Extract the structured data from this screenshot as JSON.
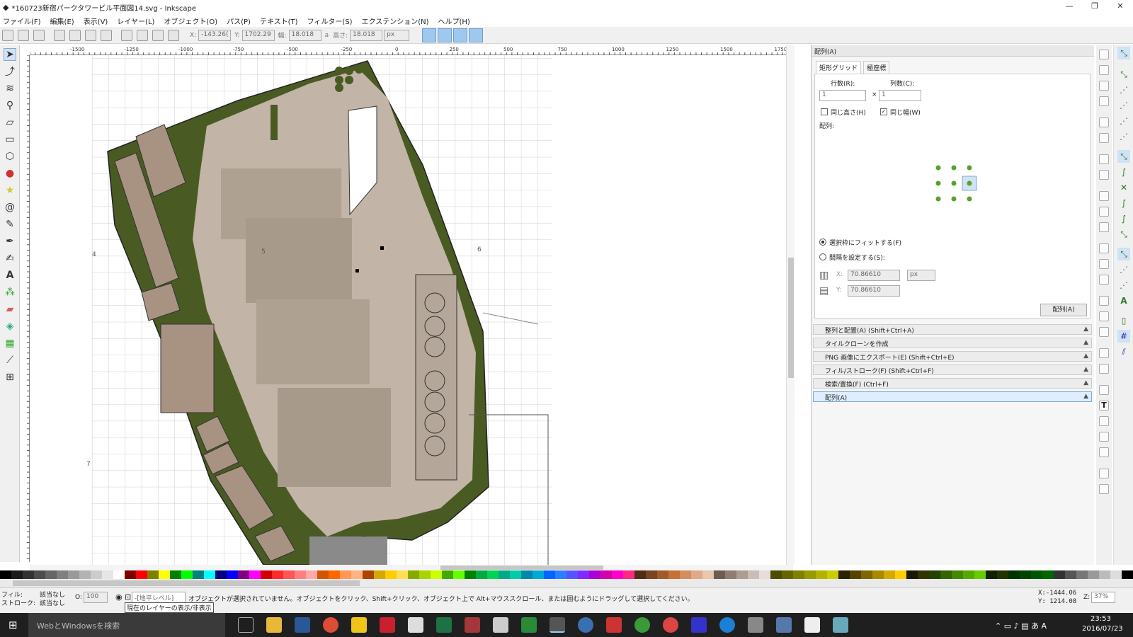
{
  "window": {
    "title": "*160723新宿パークタワービル平面図14.svg - Inkscape",
    "minimize": "—",
    "maximize": "❐",
    "close": "✕"
  },
  "menu": [
    "ファイル(F)",
    "編集(E)",
    "表示(V)",
    "レイヤー(L)",
    "オブジェクト(O)",
    "パス(P)",
    "テキスト(T)",
    "フィルター(S)",
    "エクステンション(N)",
    "ヘルプ(H)"
  ],
  "toolcontrols": {
    "x_label": "X:",
    "x_value": "-143.26(",
    "y_label": "Y:",
    "y_value": "1702.29",
    "w_label": "幅:",
    "w_value": "18.018",
    "h_label": "高さ:",
    "h_value": "18.018",
    "unit": "px"
  },
  "ruler": {
    "h_ticks": [
      "-1500",
      "-1250",
      "-1000",
      "-750",
      "-500",
      "-250",
      "0",
      "250",
      "500",
      "750",
      "1000",
      "1250",
      "1500",
      "1750"
    ]
  },
  "canvas": {
    "labels": [
      "4",
      "5",
      "6",
      "7"
    ]
  },
  "panel": {
    "title": "配列(A)",
    "tabs": [
      "矩形グリッド",
      "極座標"
    ],
    "rows_label": "行数(R):",
    "rows_value": "1",
    "times": "×",
    "cols_label": "列数(C):",
    "cols_value": "1",
    "same_height": "同じ高さ(H)",
    "same_width": "同じ幅(W)",
    "align_label": "配列:",
    "fit_bbox": "選択枠にフィットする(F)",
    "set_spacing": "間隔を設定する(S):",
    "x_label": "X:",
    "x_value": "70.86610",
    "y_label": "Y:",
    "y_value": "70.86610",
    "unit": "px",
    "arrange_button": "配列(A)",
    "docks": [
      "整列と配置(A) (Shift+Ctrl+A)",
      "タイルクローンを作成",
      "PNG 画像にエクスポート(E) (Shift+Ctrl+E)",
      "フィル/ストローク(F) (Shift+Ctrl+F)",
      "検索/置換(F) (Ctrl+F)",
      "配列(A)"
    ]
  },
  "status": {
    "fill_label": "フィル:",
    "fill_value": "該当なし",
    "stroke_label": "ストローク:",
    "stroke_value": "該当なし",
    "opacity_label": "O:",
    "opacity_value": "100",
    "layer": "-[地平レベル]",
    "message": "オブジェクトが選択されていません。オブジェクトをクリック、Shift+クリック、オブジェクト上で Alt+マウススクロール、または囲むようにドラッグして選択してください。",
    "tooltip": "現在のレイヤーの表示/非表示",
    "coord_x": "X:-1444.06",
    "coord_y": "Y: 1214.08",
    "zoom_label": "Z:",
    "zoom_value": "37%"
  },
  "taskbar": {
    "search_placeholder": "WebとWindowsを検索",
    "time": "23:53",
    "date": "2016/07/23"
  },
  "colors": {
    "accent": "#9fc8ef",
    "grass": "#4a5a23",
    "paving": "#c2b4a7",
    "plaza": "#aea191",
    "building": "#a89282"
  }
}
